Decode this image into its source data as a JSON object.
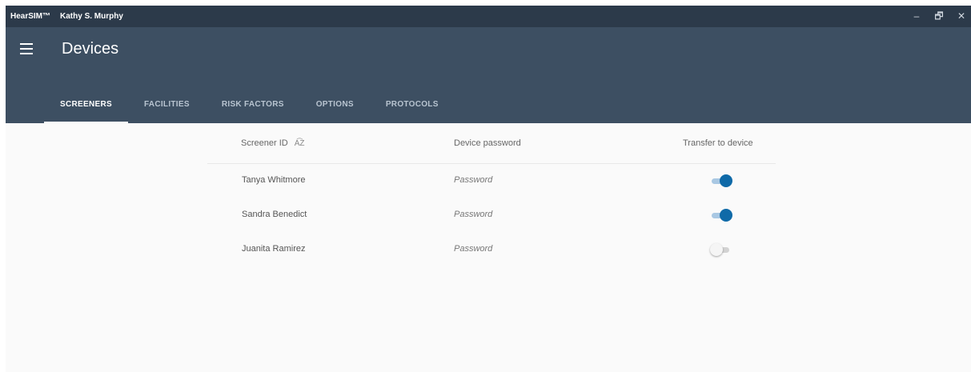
{
  "titlebar": {
    "app_name": "HearSIM™",
    "user_name": "Kathy S. Murphy",
    "minimize": "–",
    "restore": "🗗",
    "close": "✕"
  },
  "header": {
    "menu_icon": "menu-icon",
    "title": "Devices"
  },
  "tabs": [
    {
      "label": "SCREENERS",
      "active": true
    },
    {
      "label": "FACILITIES",
      "active": false
    },
    {
      "label": "RISK FACTORS",
      "active": false
    },
    {
      "label": "OPTIONS",
      "active": false
    },
    {
      "label": "PROTOCOLS",
      "active": false
    }
  ],
  "table": {
    "columns": {
      "screener_id": "Screener ID",
      "sort_icon": "A͡Z",
      "device_password": "Device password",
      "transfer": "Transfer to device"
    },
    "rows": [
      {
        "name": "Tanya Whitmore",
        "password": "Password",
        "transfer": true
      },
      {
        "name": "Sandra Benedict",
        "password": "Password",
        "transfer": true
      },
      {
        "name": "Juanita Ramirez",
        "password": "Password",
        "transfer": false
      }
    ]
  },
  "colors": {
    "titlebar": "#2c3a4a",
    "appbar": "#3d4f62",
    "toggle_on": "#0f6aa8",
    "background": "#fafafa"
  }
}
